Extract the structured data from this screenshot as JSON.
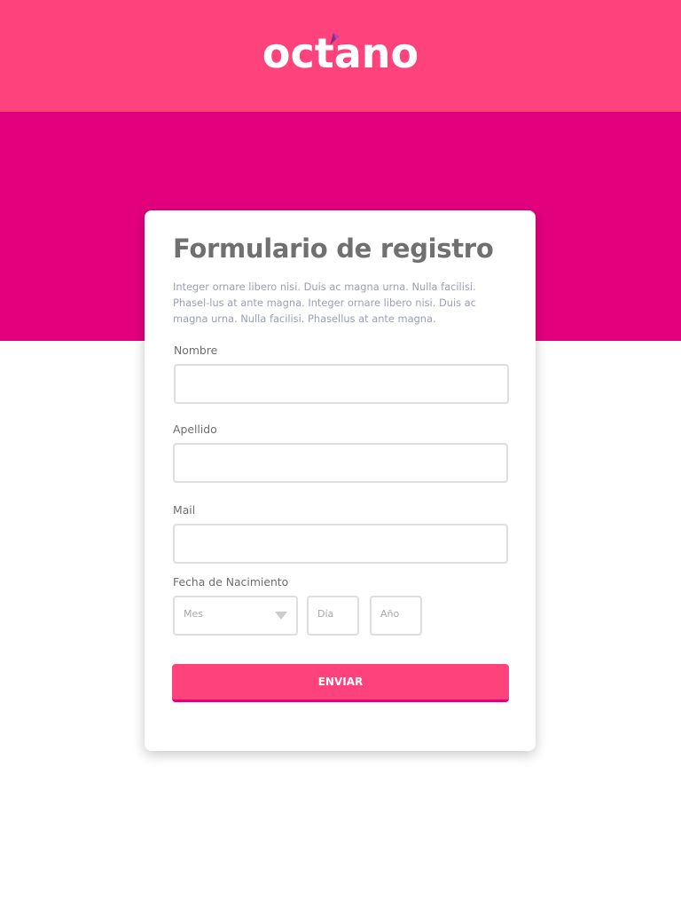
{
  "brand": {
    "logo_text": "octano",
    "colors": {
      "header": "#fe427c",
      "hero": "#e3007d",
      "accent_leaf": "#8e2a8a"
    }
  },
  "form": {
    "title": "Formulario de registro",
    "description": "Integer ornare libero nisi. Duis ac magna urna. Nulla facilisi. Phasel-lus at ante magna. Integer ornare libero nisi. Duis ac magna urna. Nulla facilisi. Phasellus at ante magna.",
    "fields": {
      "nombre": {
        "label": "Nombre",
        "value": ""
      },
      "apellido": {
        "label": "Apellido",
        "value": ""
      },
      "mail": {
        "label": "Mail",
        "value": ""
      }
    },
    "birthdate": {
      "label": "Fecha de Nacimiento",
      "month_placeholder": "Mes",
      "day_placeholder": "Día",
      "year_placeholder": "Año"
    },
    "submit_label": "ENVIAR"
  }
}
